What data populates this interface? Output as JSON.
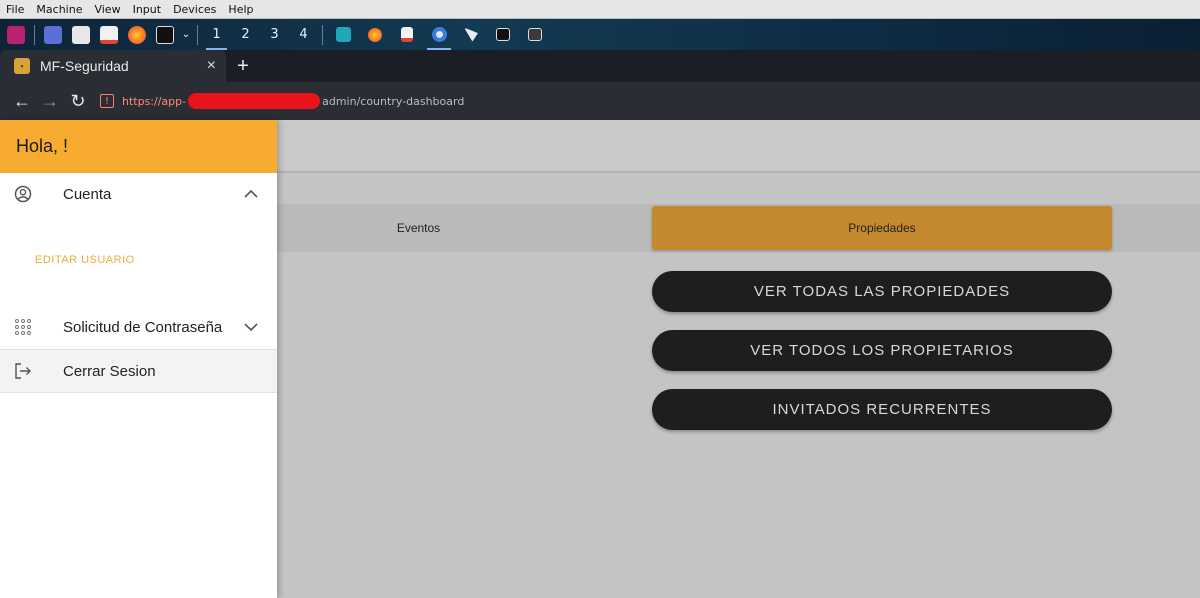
{
  "vm_menu": [
    "File",
    "Machine",
    "View",
    "Input",
    "Devices",
    "Help"
  ],
  "taskbar": {
    "workspaces": [
      "1",
      "2",
      "3",
      "4"
    ]
  },
  "browser": {
    "tab_title": "MF-Seguridad",
    "tab_close": "×",
    "new_tab": "+",
    "url_scheme": "https://app-",
    "url_path": "admin/country-dashboard"
  },
  "drawer": {
    "greeting": "Hola, !",
    "account_label": "Cuenta",
    "edit_user_label": "EDITAR USUARIO",
    "password_request_label": "Solicitud de Contraseña",
    "logout_label": "Cerrar Sesion"
  },
  "main": {
    "tabs": [
      "Eventos",
      "Propiedades"
    ],
    "actions": [
      "VER TODAS LAS PROPIEDADES",
      "VER TODOS LOS PROPIETARIOS",
      "INVITADOS RECURRENTES"
    ]
  },
  "colors": {
    "drawer_header": "#f7ab30",
    "active_tab": "#c4892d",
    "action_button": "#1e1e1e",
    "sub_item": "#f0ab3a"
  }
}
